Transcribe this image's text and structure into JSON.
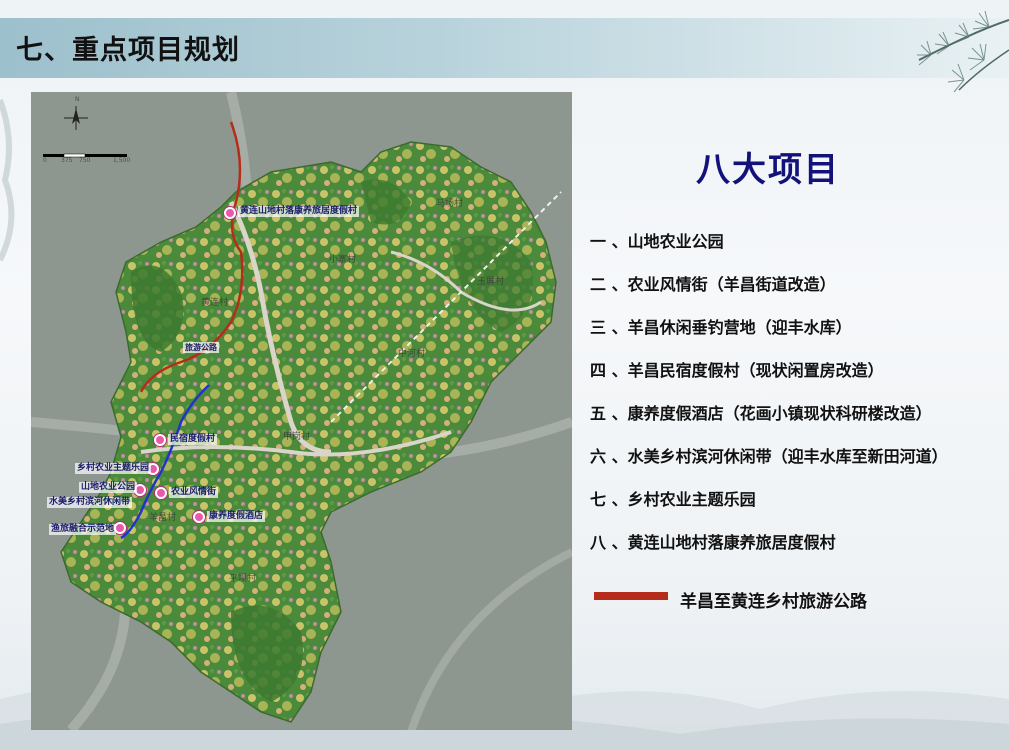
{
  "header": {
    "title": "七、重点项目规划"
  },
  "map": {
    "scale_labels": [
      "0",
      "375",
      "750",
      "1,500"
    ],
    "compass_label": "N",
    "place_labels": [
      "马场村",
      "小寨村",
      "玉屏村",
      "黄连村",
      "中河村",
      "甲岗村",
      "羊昌村",
      "平坝村"
    ],
    "poi_labels": [
      "黄连山地村落康养旅居度假村",
      "旅游公路",
      "民宿度假村",
      "乡村农业主题乐园",
      "山地农业公园",
      "农业风情街",
      "水美乡村滨河休闲带",
      "康养度假酒店",
      "渔旅融合示范地"
    ]
  },
  "panel": {
    "title": "八大项目",
    "projects": [
      "一 、山地农业公园",
      "二 、农业风情街（羊昌街道改造）",
      "三 、羊昌休闲垂钓营地（迎丰水库）",
      "四 、羊昌民宿度假村（现状闲置房改造）",
      "五 、康养度假酒店（花画小镇现状科研楼改造）",
      "六 、水美乡村滨河休闲带（迎丰水库至新田河道）",
      "七 、乡村农业主题乐园",
      "八 、黄连山地村落康养旅居度假村"
    ],
    "legend_label": "羊昌至黄连乡村旅游公路",
    "legend_color": "#b52d1a"
  }
}
